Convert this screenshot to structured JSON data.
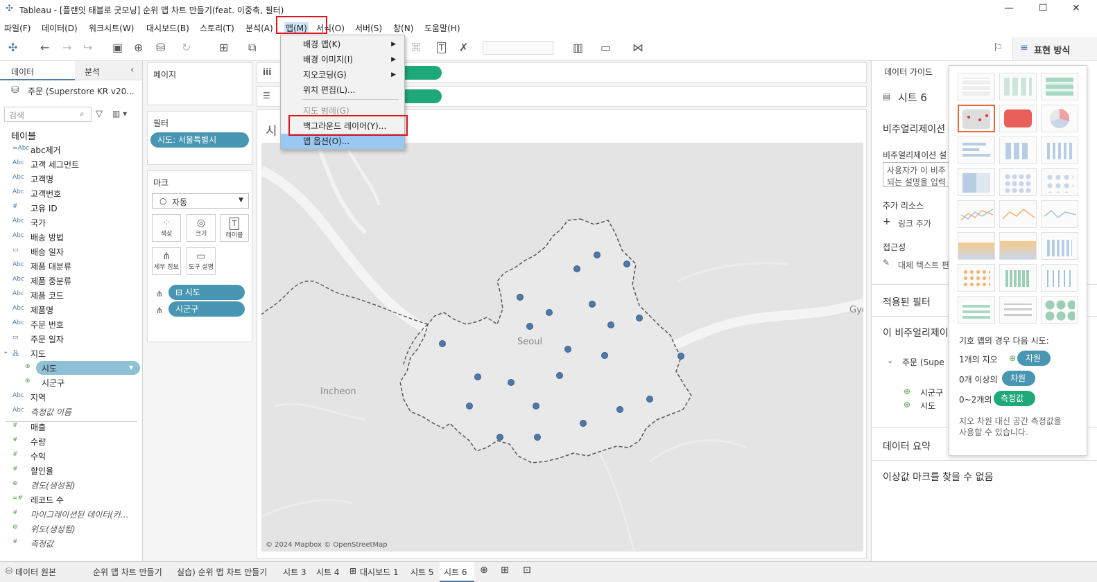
{
  "window": {
    "title": "Tableau - [플랜잇 태블로 굿모닝] 순위 맵 차트 만들기(feat. 이중축, 필터)"
  },
  "menubar": [
    "파일(F)",
    "데이터(D)",
    "워크시트(W)",
    "대시보드(B)",
    "스토리(T)",
    "분석(A)",
    "맵(M)",
    "서식(O)",
    "서버(S)",
    "창(N)",
    "도움말(H)"
  ],
  "toolbar": {
    "show_me_label": "표현 방식"
  },
  "map_menu": {
    "items": [
      {
        "label": "배경 맵(K)",
        "sub": true
      },
      {
        "label": "배경 이미지(I)",
        "sub": true
      },
      {
        "label": "지오코딩(G)",
        "sub": true
      },
      {
        "label": "위치 편집(L)...",
        "sub": false
      },
      {
        "label": "지도 범례(G)",
        "disabled": true
      },
      {
        "label": "백그라운드 레이어(Y)..."
      },
      {
        "label": "맵 옵션(O)...",
        "highlighted": true
      }
    ]
  },
  "data_pane": {
    "tab_data": "데이터",
    "tab_analysis": "분석",
    "datasource": "주문 (Superstore KR v20...",
    "search_placeholder": "검색",
    "tables_header": "테이블",
    "fields": [
      {
        "type": "=Abc",
        "name": "abc제거"
      },
      {
        "type": "Abc",
        "name": "고객 세그먼트"
      },
      {
        "type": "Abc",
        "name": "고객명"
      },
      {
        "type": "Abc",
        "name": "고객번호"
      },
      {
        "type": "#",
        "name": "고유 ID"
      },
      {
        "type": "Abc",
        "name": "국가"
      },
      {
        "type": "Abc",
        "name": "배송 방법"
      },
      {
        "type": "date",
        "name": "배송 일자"
      },
      {
        "type": "Abc",
        "name": "제품 대분류"
      },
      {
        "type": "Abc",
        "name": "제품 중분류"
      },
      {
        "type": "Abc",
        "name": "제품 코드"
      },
      {
        "type": "Abc",
        "name": "제품명"
      },
      {
        "type": "Abc",
        "name": "주문 번호"
      },
      {
        "type": "date",
        "name": "주문 일자"
      },
      {
        "type": "hier",
        "name": "지도"
      },
      {
        "type": "geo",
        "name": "시도",
        "selected": true
      },
      {
        "type": "geo",
        "name": "시군구"
      },
      {
        "type": "Abc",
        "name": "지역"
      },
      {
        "type": "Abc",
        "name": "측정값 이름",
        "italic": true
      }
    ],
    "measures": [
      {
        "type": "#",
        "name": "매출"
      },
      {
        "type": "#",
        "name": "수량"
      },
      {
        "type": "#",
        "name": "수익"
      },
      {
        "type": "#",
        "name": "할인율"
      },
      {
        "type": "geo",
        "name": "경도(생성됨)",
        "italic": true
      },
      {
        "type": "=#",
        "name": "레코드 수"
      },
      {
        "type": "#",
        "name": "마이그레이션된 데이터(카...",
        "italic": true
      },
      {
        "type": "geo",
        "name": "위도(생성됨)",
        "italic": true
      },
      {
        "type": "#",
        "name": "측정값",
        "italic": true
      }
    ]
  },
  "shelves": {
    "pages": "페이지",
    "filters": "필터",
    "filter_pill": "시도: 서울특별시",
    "marks": "마크",
    "mark_type": "자동",
    "mark_buttons": [
      "색상",
      "크기",
      "레이블",
      "세부 정보",
      "도구 설명"
    ],
    "mark_pills": [
      "시도",
      "시군구"
    ],
    "columns_icon": "iii",
    "rows_icon": "☰"
  },
  "view": {
    "title_initial": "시",
    "map_labels": [
      "Seoul",
      "Incheon",
      "Gyeo"
    ],
    "attribution": "© 2024 Mapbox © OpenStreetMap"
  },
  "guide": {
    "header": "데이터 가이드",
    "sheet": "시트 6",
    "viz_desc_title": "비주얼리제이션",
    "viz_desc_sub": "비주얼리제이션 설",
    "desc_box": "사용자가 이 비주\n되는 설명을 입력",
    "resources": "추가 리소스",
    "add_link": "링크 추가",
    "accessibility": "접근성",
    "alt_text": "대체 텍스트 편",
    "applied_filters": "적용된 필터",
    "this_viz": "이 비주얼리제이",
    "source": "주문 (Supe",
    "geo1": "시군구",
    "geo2": "시도",
    "data_summary": "데이터 요약",
    "outlier": "이상값 마크를 찾을 수 없음"
  },
  "showme": {
    "hint_title": "기호 맵의 경우 다음 시도:",
    "line1": "1개의 지오",
    "line1_pill": "차원",
    "line2": "0개 이상의",
    "line2_pill": "차원",
    "line3": "0~2개의",
    "line3_pill": "측정값",
    "footer1": "지오 차원 대신 공간 측정값을",
    "footer2": "사용할 수 있습니다."
  },
  "statusbar": {
    "tabs": [
      "데이터 원본",
      "순위 맵 차트 만들기",
      "실습) 순위 맵 차트 만들기",
      "시트 3",
      "시트 4",
      "대시보드 1",
      "시트 5",
      "시트 6"
    ],
    "active": "시트 6"
  },
  "colors": {
    "pill_blue": "#4996b2",
    "pill_green": "#1fa87a",
    "mark_blue": "#4e79a7",
    "highlight": "#99c8f2",
    "red": "#e0141e"
  }
}
